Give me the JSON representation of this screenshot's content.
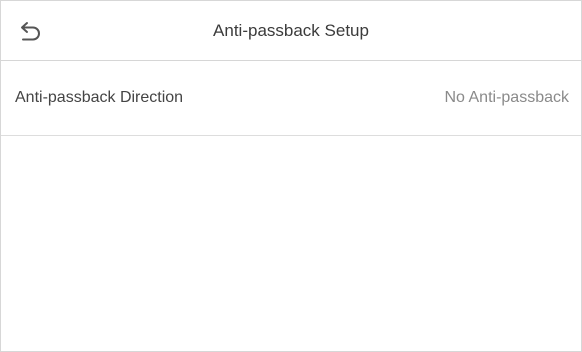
{
  "header": {
    "back_icon": "back-arrow-icon",
    "title": "Anti-passback Setup"
  },
  "settings": [
    {
      "label": "Anti-passback Direction",
      "value": "No Anti-passback"
    }
  ]
}
